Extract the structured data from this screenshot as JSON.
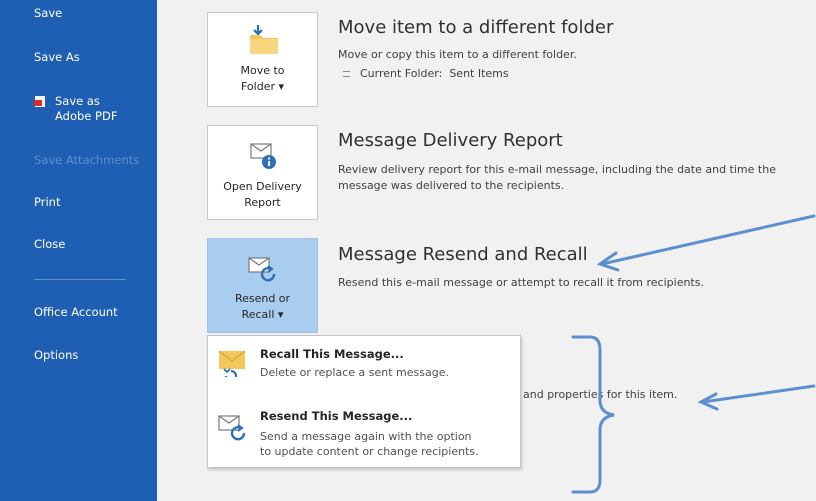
{
  "sidebar": {
    "items": [
      {
        "label": "Save",
        "enabled": true
      },
      {
        "label": "Save As",
        "enabled": true
      },
      {
        "label": "Save as",
        "label2": "Adobe PDF",
        "enabled": true
      },
      {
        "label": "Save Attachments",
        "enabled": false
      },
      {
        "label": "Print",
        "enabled": true
      },
      {
        "label": "Close",
        "enabled": true
      },
      {
        "label": "Office Account",
        "enabled": true
      },
      {
        "label": "Options",
        "enabled": true
      }
    ]
  },
  "sections": {
    "move": {
      "button_line1": "Move to",
      "button_line2": "Folder ▾",
      "title": "Move item to a different folder",
      "desc": "Move or copy this item to a different folder.",
      "current_folder_label": "Current Folder:",
      "current_folder_value": "Sent Items"
    },
    "delivery": {
      "button_line1": "Open Delivery",
      "button_line2": "Report",
      "title": "Message Delivery Report",
      "desc1": "Review delivery report for this e-mail message, including the date and time the",
      "desc2": "message was delivered to the recipients."
    },
    "resend": {
      "button_line1": "Resend or",
      "button_line2": "Recall ▾",
      "title": "Message Resend and Recall",
      "desc": "Resend this e-mail message or attempt to recall it from recipients."
    },
    "properties_partial": "and properties for this item."
  },
  "menu": {
    "items": [
      {
        "title": "Recall This Message...",
        "desc1": "Delete or replace a sent message.",
        "desc2": "",
        "icon": "envelope-recall-icon"
      },
      {
        "title": "Resend This Message...",
        "desc1": "Send a message again with the option",
        "desc2": "to update content or change recipients.",
        "icon": "resend-icon"
      }
    ]
  },
  "colors": {
    "rail": "#1e5fb3",
    "active_button": "#a9cdee",
    "annotation": "#5b8fd0"
  }
}
